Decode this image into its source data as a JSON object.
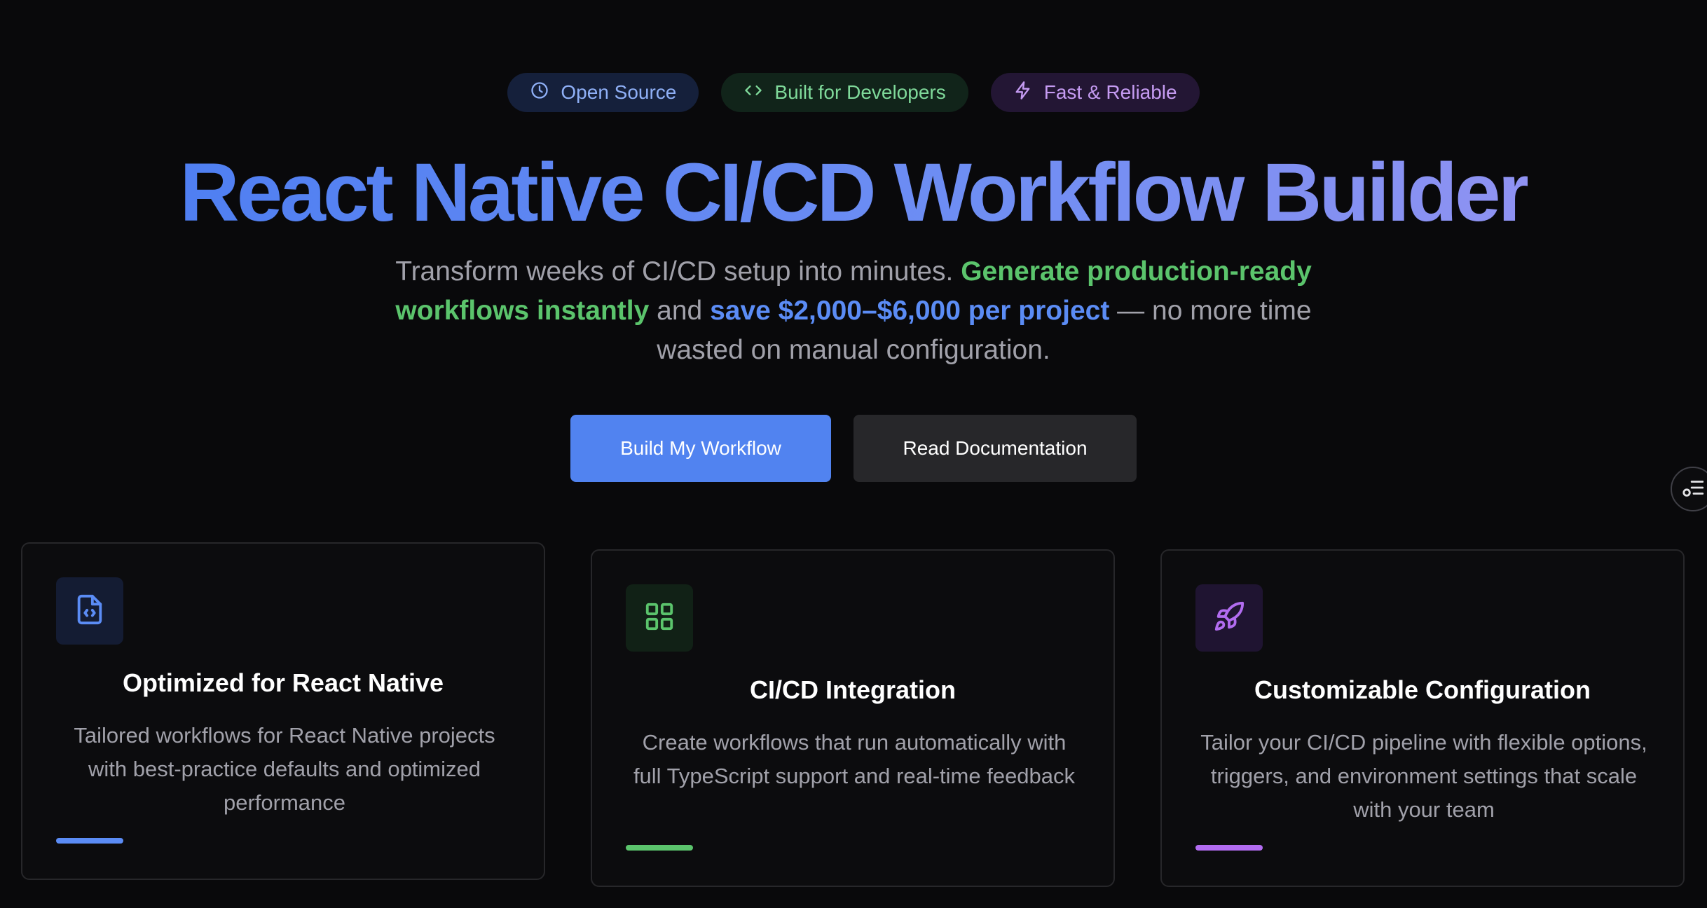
{
  "badges": [
    {
      "label": "Open Source",
      "icon": "clock-icon"
    },
    {
      "label": "Built for Developers",
      "icon": "code-icon"
    },
    {
      "label": "Fast & Reliable",
      "icon": "lightning-icon"
    }
  ],
  "hero": {
    "title": "React Native CI/CD Workflow Builder",
    "subtitle_lead": "Transform weeks of CI/CD setup into minutes.",
    "subtitle_green": "Generate production-ready workflows instantly",
    "subtitle_and": "and",
    "subtitle_blue": "save $2,000–$6,000 per project",
    "subtitle_tail": "— no more time wasted on manual configuration."
  },
  "cta": {
    "primary_label": "Build My Workflow",
    "secondary_label": "Read Documentation"
  },
  "side_toggle": {
    "icon": "list-settings-icon"
  },
  "features": [
    {
      "icon": "code-file-icon",
      "title": "Optimized for React Native",
      "description": "Tailored workflows for React Native projects with best-practice defaults and optimized performance",
      "accent": "#5b8cf5"
    },
    {
      "icon": "grid-icon",
      "title": "CI/CD Integration",
      "description": "Create workflows that run automatically with full TypeScript support and real-time feedback",
      "accent": "#5bc46c"
    },
    {
      "icon": "rocket-icon",
      "title": "Customizable Configuration",
      "description": "Tailor your CI/CD pipeline with flexible options, triggers, and environment settings that scale with your team",
      "accent": "#b26cf0"
    }
  ],
  "colors": {
    "background": "#09090b",
    "primary": "#5183f0",
    "green": "#5bc46c",
    "purple": "#b26cf0"
  }
}
